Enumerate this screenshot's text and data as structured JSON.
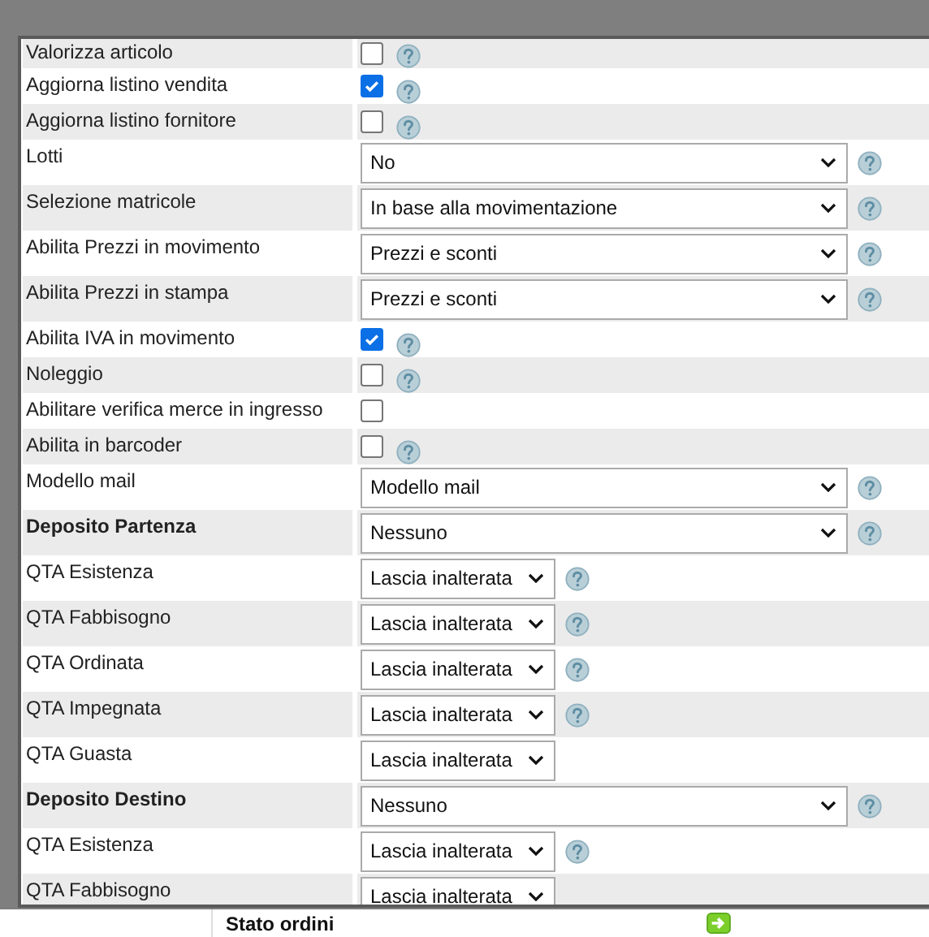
{
  "form": {
    "rows": [
      {
        "label": "Valorizza articolo",
        "kind": "checkbox",
        "checked": false,
        "help": true
      },
      {
        "label": "Aggiorna listino vendita",
        "kind": "checkbox",
        "checked": true,
        "help": true
      },
      {
        "label": "Aggiorna listino fornitore",
        "kind": "checkbox",
        "checked": false,
        "help": true
      },
      {
        "label": "Lotti",
        "kind": "select",
        "value": "No",
        "help": true
      },
      {
        "label": "Selezione matricole",
        "kind": "select",
        "value": "In base alla movimentazione",
        "help": true
      },
      {
        "label": "Abilita Prezzi in movimento",
        "kind": "select",
        "value": "Prezzi e sconti",
        "help": true
      },
      {
        "label": "Abilita Prezzi in stampa",
        "kind": "select",
        "value": "Prezzi e sconti",
        "help": true
      },
      {
        "label": "Abilita IVA in movimento",
        "kind": "checkbox",
        "checked": true,
        "help": true
      },
      {
        "label": "Noleggio",
        "kind": "checkbox",
        "checked": false,
        "help": true
      },
      {
        "label": "Abilitare verifica merce in ingresso",
        "kind": "checkbox",
        "checked": false,
        "help": false
      },
      {
        "label": "Abilita in barcoder",
        "kind": "checkbox",
        "checked": false,
        "help": true
      },
      {
        "label": "Modello mail",
        "kind": "select",
        "value": "Modello mail",
        "help": true
      },
      {
        "label": "Deposito Partenza",
        "kind": "select",
        "value": "Nessuno",
        "help": true,
        "heading": true
      },
      {
        "label": "QTA Esistenza",
        "kind": "minselect",
        "value": "Lascia inalterata",
        "help": true
      },
      {
        "label": "QTA Fabbisogno",
        "kind": "minselect",
        "value": "Lascia inalterata",
        "help": true
      },
      {
        "label": "QTA Ordinata",
        "kind": "minselect",
        "value": "Lascia inalterata",
        "help": true
      },
      {
        "label": "QTA Impegnata",
        "kind": "minselect",
        "value": "Lascia inalterata",
        "help": true
      },
      {
        "label": "QTA Guasta",
        "kind": "minselect",
        "value": "Lascia inalterata",
        "help": false
      },
      {
        "label": "Deposito Destino",
        "kind": "select",
        "value": "Nessuno",
        "help": true,
        "heading": true
      },
      {
        "label": "QTA Esistenza",
        "kind": "minselect",
        "value": "Lascia inalterata",
        "help": true
      },
      {
        "label": "QTA Fabbisogno",
        "kind": "minselect",
        "value": "Lascia inalterata",
        "help": false
      }
    ]
  },
  "background_page": {
    "label": "Stato ordini"
  }
}
